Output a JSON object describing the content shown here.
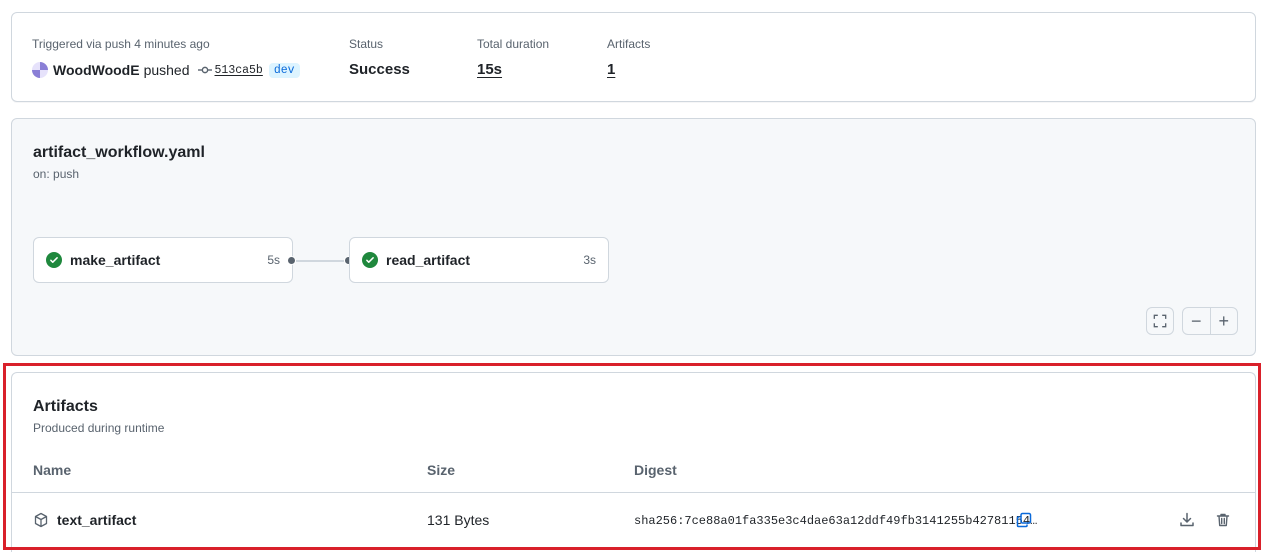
{
  "summary": {
    "trigger_label": "Triggered via push 4 minutes ago",
    "actor": "WoodWoodE",
    "action": "pushed",
    "commit_sha": "513ca5b",
    "branch": "dev",
    "status_label": "Status",
    "status_value": "Success",
    "duration_label": "Total duration",
    "duration_value": "15s",
    "artifacts_label": "Artifacts",
    "artifacts_value": "1"
  },
  "workflow": {
    "file": "artifact_workflow.yaml",
    "trigger": "on: push",
    "jobs": [
      {
        "name": "make_artifact",
        "duration": "5s",
        "status": "success"
      },
      {
        "name": "read_artifact",
        "duration": "3s",
        "status": "success"
      }
    ],
    "controls": {
      "fullscreen_icon": "fullscreen-icon",
      "zoom_out": "−",
      "zoom_in": "+"
    }
  },
  "artifacts": {
    "title": "Artifacts",
    "subtitle": "Produced during runtime",
    "columns": [
      "Name",
      "Size",
      "Digest"
    ],
    "rows": [
      {
        "name": "text_artifact",
        "size": "131 Bytes",
        "digest": "sha256:7ce88a01fa335e3c4dae63a12ddf49fb3141255b42781154…"
      }
    ]
  },
  "colors": {
    "success": "#1f883d",
    "link": "#0969da",
    "highlight": "#d9202a",
    "border": "#d0d7de"
  }
}
